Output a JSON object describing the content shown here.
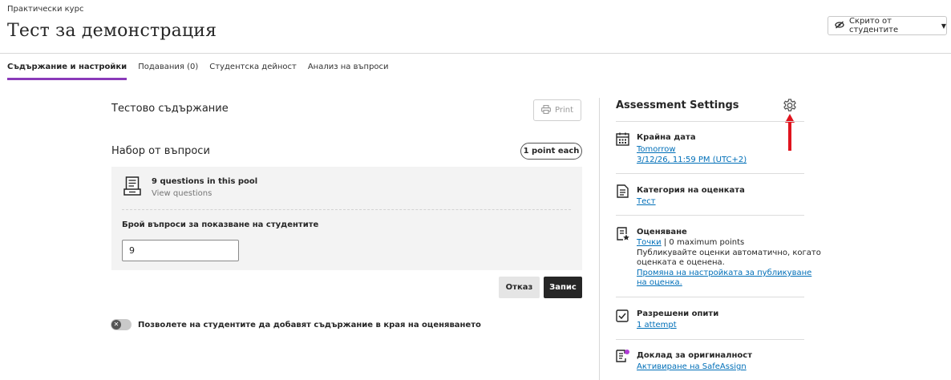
{
  "header": {
    "course_name": "Практически курс",
    "title": "Тест за демонстрация",
    "visibility_label": "Скрито от студентите"
  },
  "tabs": [
    {
      "label": "Съдържание и настройки",
      "active": true
    },
    {
      "label": "Подавания (0)",
      "active": false
    },
    {
      "label": "Студентска дейност",
      "active": false
    },
    {
      "label": "Анализ на въпроси",
      "active": false
    }
  ],
  "content": {
    "test_content_title": "Тестово съдържание",
    "print_label": "Print",
    "question_set_title": "Набор от въпроси",
    "points_label": "1 point each",
    "pool": {
      "title": "9 questions in this pool",
      "view_link": "View questions"
    },
    "count_label": "Брой въпроси за показване на студентите",
    "count_value": "9",
    "cancel_label": "Отказ",
    "save_label": "Запис",
    "toggle_label": "Позволете на студентите да добавят съдържание в края на оценяването"
  },
  "settings": {
    "title": "Assessment Settings",
    "due_date": {
      "heading": "Крайна дата",
      "link1": "Tomorrow",
      "link2": "3/12/26, 11:59 PM (UTC+2)"
    },
    "grade_category": {
      "heading": "Категория на оценката",
      "link": "Тест"
    },
    "grading": {
      "heading": "Оценяване",
      "link_points": "Точки",
      "points_rest": " | 0 maximum points",
      "line2": "Публикувайте оценки автоматично, когато",
      "line3": "оценката е оценена.",
      "link_change1": "Промяна на настройката за публикуване",
      "link_change2": "на оценка."
    },
    "attempts": {
      "heading": "Разрешени опити",
      "link": "1 attempt"
    },
    "originality": {
      "heading": "Доклад за оригиналност",
      "link": "Активиране на SafeAssign"
    }
  },
  "colors": {
    "accent_tab": "#8a3ab9",
    "link": "#006fb8",
    "annotation_arrow": "#e0141e",
    "originality_dot": "#b03cd6"
  }
}
